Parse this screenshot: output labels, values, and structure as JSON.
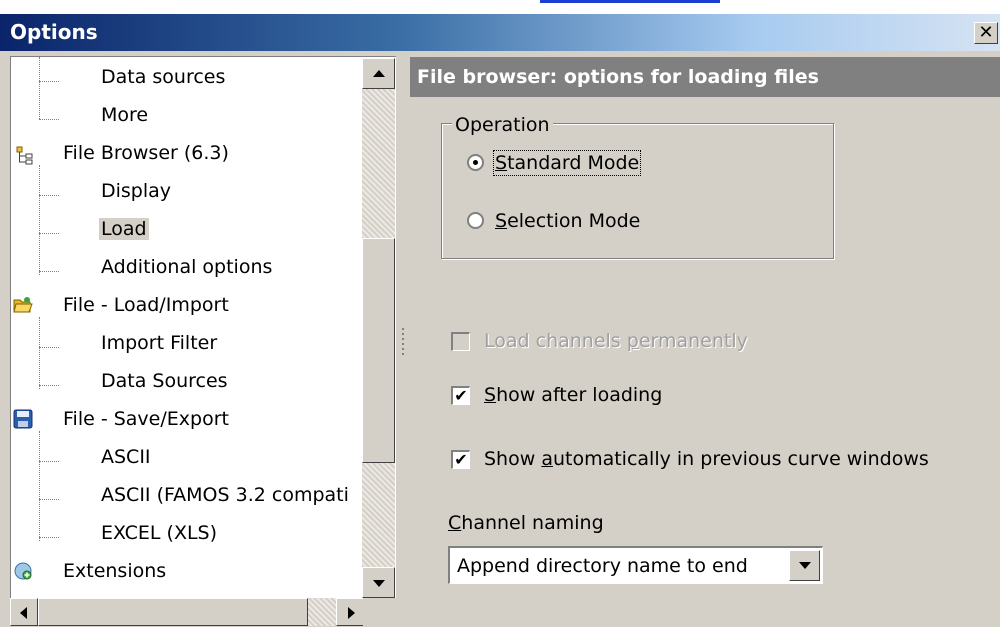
{
  "window": {
    "title": "Options",
    "close_label": "✕"
  },
  "tree": {
    "items": [
      {
        "label": "Data sources",
        "level": 1
      },
      {
        "label": "More",
        "level": 1
      },
      {
        "label": "File Browser (6.3)",
        "level": 0,
        "icon": "tree-structure-icon"
      },
      {
        "label": "Display",
        "level": 1
      },
      {
        "label": "Load",
        "level": 1,
        "selected": true
      },
      {
        "label": "Additional options",
        "level": 1
      },
      {
        "label": "File - Load/Import",
        "level": 0,
        "icon": "folder-open-icon"
      },
      {
        "label": "Import Filter",
        "level": 1
      },
      {
        "label": "Data Sources",
        "level": 1
      },
      {
        "label": "File - Save/Export",
        "level": 0,
        "icon": "floppy-disk-icon"
      },
      {
        "label": "ASCII",
        "level": 1
      },
      {
        "label": "ASCII (FAMOS 3.2 compati",
        "level": 1
      },
      {
        "label": "EXCEL (XLS)",
        "level": 1
      },
      {
        "label": "Extensions",
        "level": 0,
        "icon": "extensions-icon"
      }
    ]
  },
  "panel": {
    "header": "File browser: options for loading files",
    "operation_group": {
      "label": "Operation",
      "options": [
        {
          "label": "Standard Mode",
          "accel": "S",
          "rest": "tandard Mode",
          "checked": true
        },
        {
          "label": "Selection Mode",
          "accel": "S",
          "rest": "election Mode",
          "checked": false
        }
      ]
    },
    "checkboxes": [
      {
        "label": "Load channels permanently",
        "pre": "Load channels ",
        "accel": "p",
        "post": "ermanently",
        "checked": false,
        "enabled": false
      },
      {
        "label": "Show after loading",
        "pre": "",
        "accel": "S",
        "post": "how after loading",
        "checked": true,
        "enabled": true
      },
      {
        "label": "Show automatically in previous curve windows",
        "pre": "Show ",
        "accel": "a",
        "post": "utomatically in previous curve windows",
        "checked": true,
        "enabled": true
      }
    ],
    "channel_naming": {
      "label": "Channel naming",
      "accel": "C",
      "rest": "hannel naming",
      "selected": "Append directory name to end"
    }
  },
  "colors": {
    "titlebar_start": "#0a246a",
    "dialog_bg": "#d4d0c8",
    "header_bg": "#808080"
  }
}
